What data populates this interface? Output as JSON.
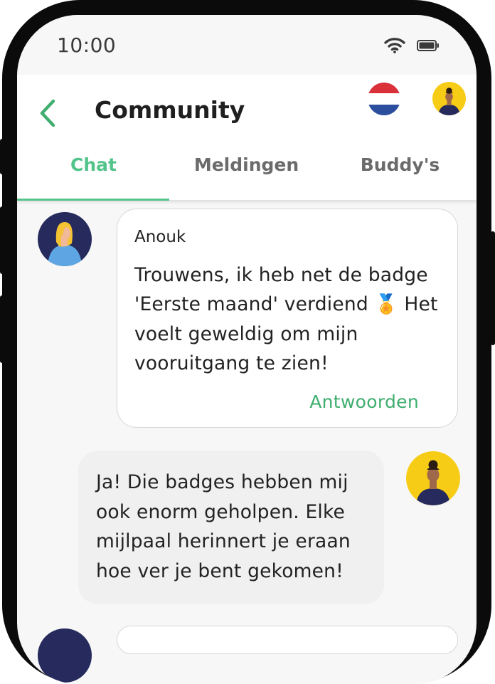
{
  "status_bar": {
    "time": "10:00",
    "wifi_icon": "wifi-icon",
    "battery_icon": "battery-icon"
  },
  "header": {
    "back_icon": "chevron-left-icon",
    "title": "Community",
    "language_flag": "netherlands-flag",
    "profile_avatar": "avatar-icon"
  },
  "tabs": [
    {
      "label": "Chat",
      "active": true
    },
    {
      "label": "Meldingen",
      "active": false
    },
    {
      "label": "Buddy's",
      "active": false
    }
  ],
  "messages": [
    {
      "direction": "incoming",
      "sender": "Anouk",
      "lines": [
        "Trouwens, ik heb net de badge",
        "'Eerste maand' verdiend 🏅 Het",
        "voelt geweldig om mijn",
        "vooruitgang te zien!"
      ],
      "reply_label": "Antwoorden"
    },
    {
      "direction": "outgoing",
      "lines": [
        "Ja! Die badges hebben mij",
        "ook enorm geholpen. Elke",
        "mijlpaal herinnert je eraan",
        "hoe ver je bent gekomen!"
      ]
    }
  ],
  "colors": {
    "accent": "#52c48a",
    "reply": "#3fae6f",
    "avatar_yellow": "#f7cc17",
    "avatar_navy": "#262a5c"
  }
}
